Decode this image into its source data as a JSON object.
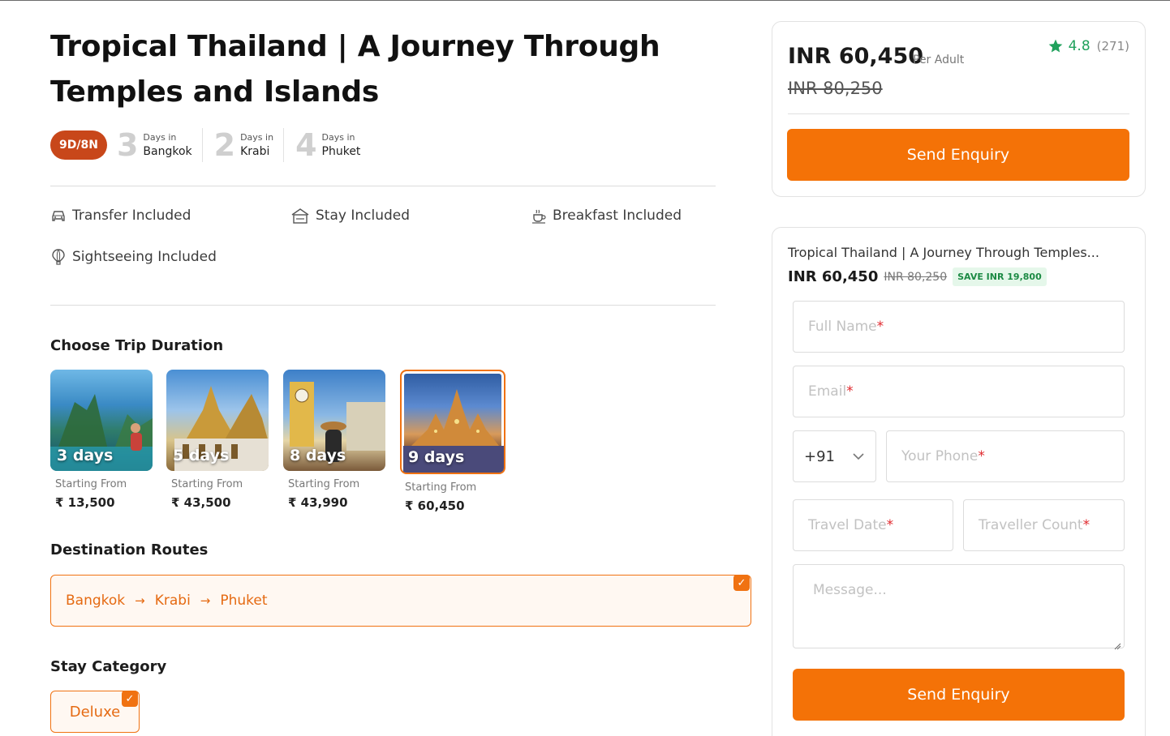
{
  "title": "Tropical Thailand | A Journey Through Temples and Islands",
  "nights_badge": "9D/8N",
  "days": [
    {
      "num": "3",
      "label": "Days in",
      "city": "Bangkok"
    },
    {
      "num": "2",
      "label": "Days in",
      "city": "Krabi"
    },
    {
      "num": "4",
      "label": "Days in",
      "city": "Phuket"
    }
  ],
  "inclusions": [
    {
      "label": "Transfer Included",
      "icon": "car-icon"
    },
    {
      "label": "Stay Included",
      "icon": "hotel-icon"
    },
    {
      "label": "Breakfast Included",
      "icon": "breakfast-icon"
    },
    {
      "label": "Sightseeing Included",
      "icon": "balloon-icon"
    }
  ],
  "duration_heading": "Choose Trip Duration",
  "durations": [
    {
      "label": "3 days",
      "from": "Starting From",
      "price": "₹ 13,500"
    },
    {
      "label": "5 days",
      "from": "Starting From",
      "price": "₹ 43,500"
    },
    {
      "label": "8 days",
      "from": "Starting From",
      "price": "₹ 43,990"
    },
    {
      "label": "9 days",
      "from": "Starting From",
      "price": "₹ 60,450",
      "selected": true
    }
  ],
  "routes_heading": "Destination Routes",
  "route": [
    "Bangkok",
    "Krabi",
    "Phuket"
  ],
  "stay_heading": "Stay Category",
  "stay_option": "Deluxe",
  "price_card": {
    "price": "INR 60,450",
    "per": "Per Adult",
    "old_price": "INR 80,250",
    "rating": "4.8",
    "rating_count": "(271)",
    "button": "Send Enquiry"
  },
  "form": {
    "title": "Tropical Thailand | A Journey Through Temples...",
    "price": "INR 60,450",
    "old_price": "INR 80,250",
    "save": "SAVE INR 19,800",
    "full_name": "Full Name",
    "email": "Email",
    "country_code": "+91",
    "phone": "Your Phone",
    "travel_date": "Travel Date",
    "traveller_count": "Traveller Count",
    "message": "Message...",
    "required_mark": "*",
    "button": "Send Enquiry"
  },
  "colors": {
    "accent": "#f47207",
    "badge": "#c8471a",
    "rating": "#20a15c",
    "required": "#e0282d"
  }
}
